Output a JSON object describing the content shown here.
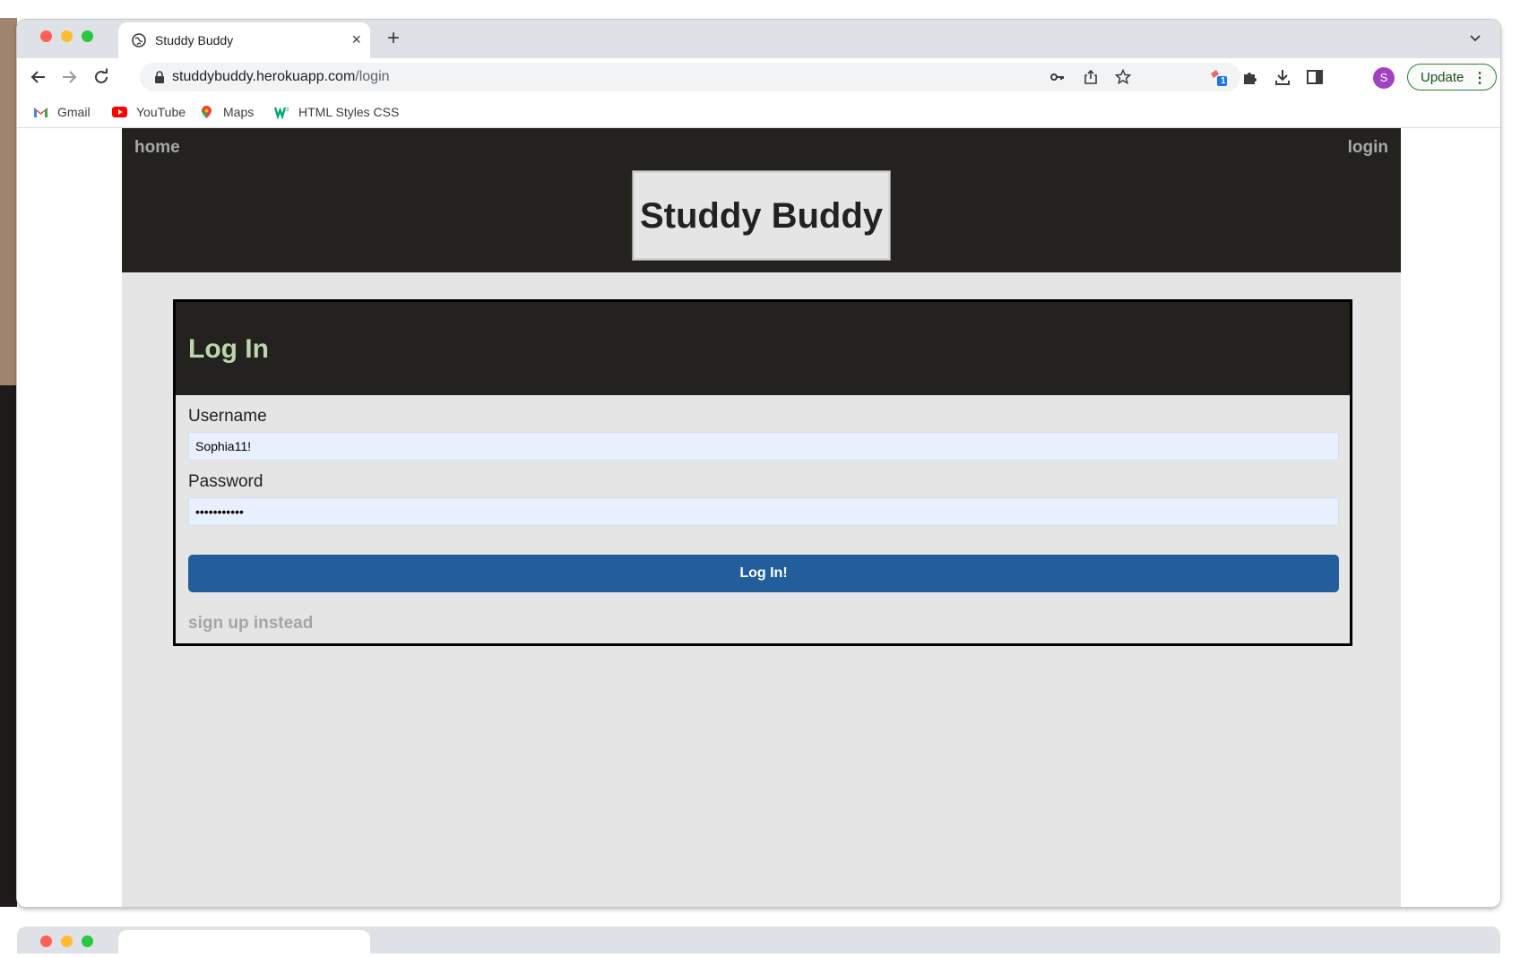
{
  "browser": {
    "tab_title": "Studdy Buddy",
    "tab_close": "×",
    "new_tab": "+",
    "url_host": "studdybuddy.herokuapp.com",
    "url_path": "/login",
    "profile_initial": "S",
    "extension_badge": "1",
    "update_label": "Update",
    "update_menu": "⋮",
    "bookmarks": [
      {
        "label": "Gmail",
        "icon": "gmail-icon"
      },
      {
        "label": "YouTube",
        "icon": "youtube-icon"
      },
      {
        "label": "Maps",
        "icon": "maps-icon"
      },
      {
        "label": "HTML Styles CSS",
        "icon": "w3schools-icon"
      }
    ]
  },
  "site": {
    "nav": {
      "home": "home",
      "login": "login"
    },
    "brand": "Studdy Buddy",
    "form": {
      "title": "Log In",
      "username_label": "Username",
      "username_value": "Sophia11!",
      "password_label": "Password",
      "password_value": "•••••••••••",
      "submit_label": "Log In!",
      "alt_link": "sign up instead"
    }
  },
  "colors": {
    "header_bg": "#23221f",
    "page_bg": "#e5e5e5",
    "form_title": "#bcd5ad",
    "submit_bg": "#225d9c",
    "muted_link": "#a5a5a5",
    "autofill_bg": "#e8f0fe"
  }
}
